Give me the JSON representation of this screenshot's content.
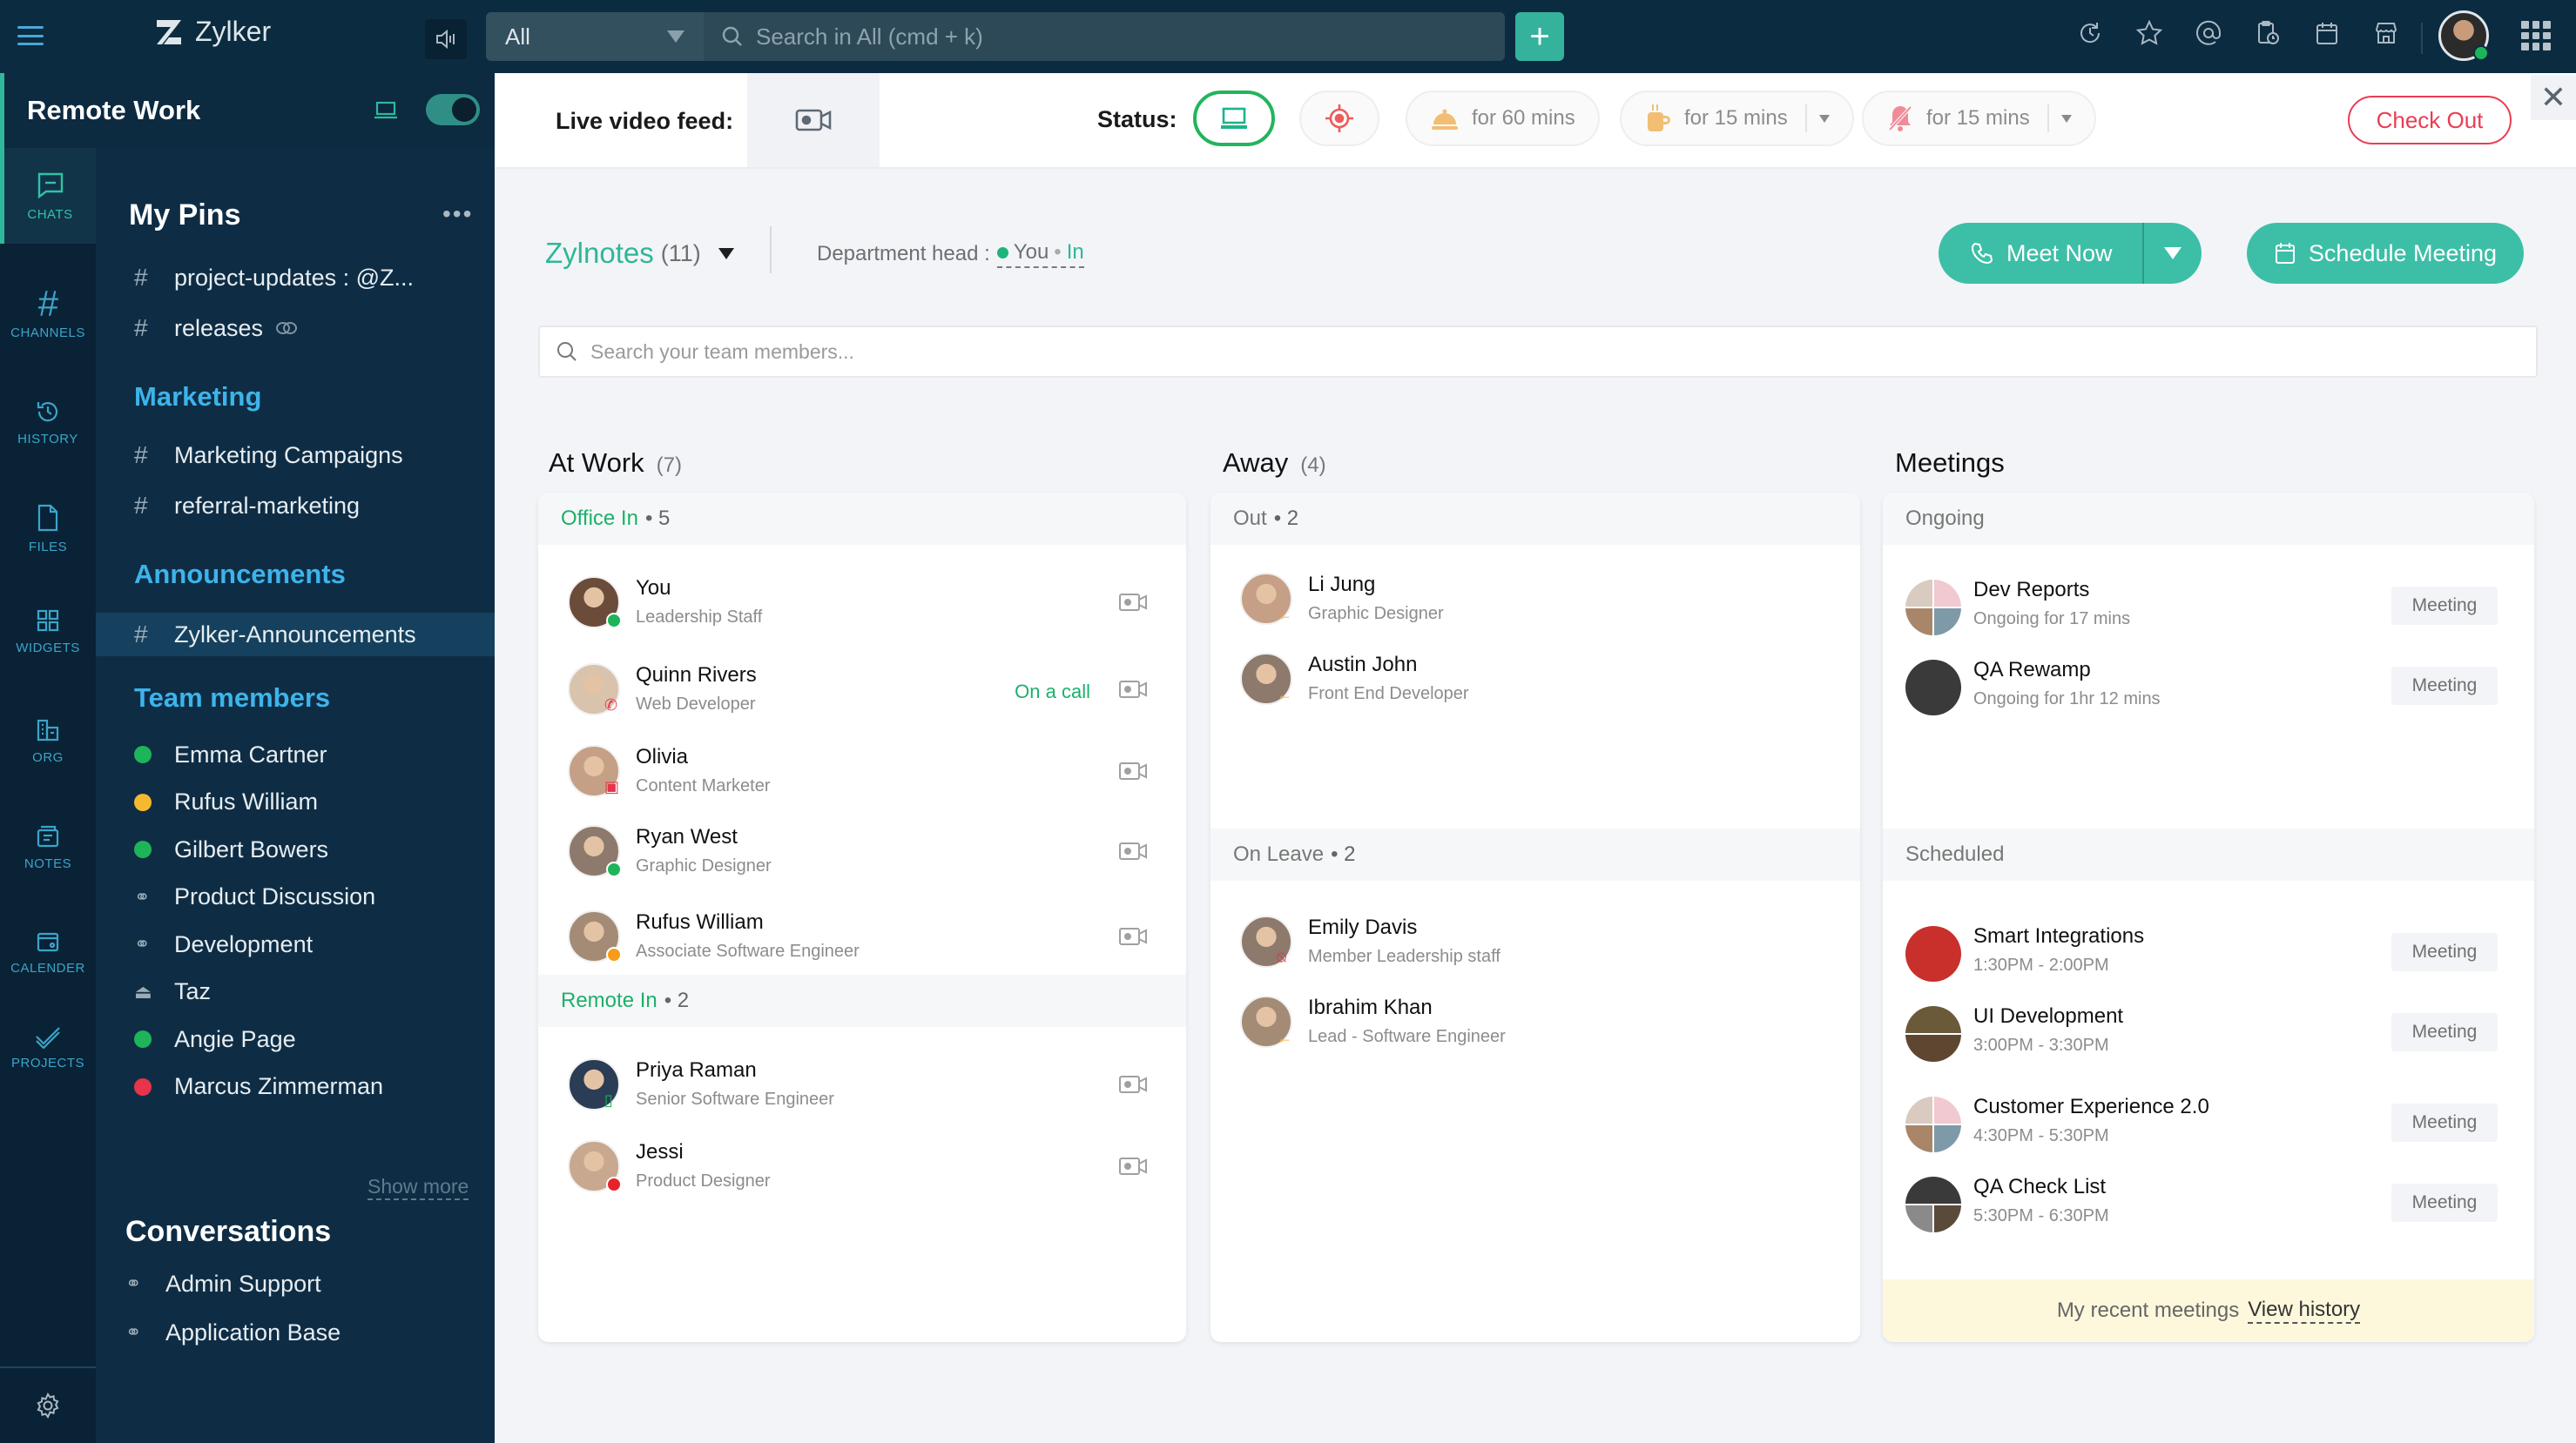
{
  "app": {
    "name": "Zylker",
    "scope_select": "All",
    "search_placeholder": "Search in All (cmd + k)",
    "add_label": "+",
    "top_icons": [
      "history-icon",
      "star-icon",
      "mention-icon",
      "clipboard-clock-icon",
      "calendar-icon",
      "store-icon"
    ],
    "user_status_color": "#1db45a"
  },
  "rail": {
    "items": [
      {
        "label": "CHATS",
        "icon": "chat-icon",
        "active": true
      },
      {
        "label": "CHANNELS",
        "icon": "hash-icon"
      },
      {
        "label": "HISTORY",
        "icon": "history-icon"
      },
      {
        "label": "FILES",
        "icon": "file-icon"
      },
      {
        "label": "WIDGETS",
        "icon": "widgets-icon"
      },
      {
        "label": "ORG",
        "icon": "org-icon"
      },
      {
        "label": "NOTES",
        "icon": "notes-icon"
      },
      {
        "label": "CALENDER",
        "icon": "calendar-icon"
      },
      {
        "label": "PROJECTS",
        "icon": "projects-icon"
      }
    ]
  },
  "sidebar": {
    "workspace": "Remote Work",
    "pins_title": "My Pins",
    "pins": [
      {
        "label": "project-updates : @Z..."
      },
      {
        "label": "releases"
      }
    ],
    "marketing_title": "Marketing",
    "marketing": [
      {
        "label": "Marketing Campaigns"
      },
      {
        "label": "referral-marketing"
      }
    ],
    "announcements_title": "Announcements",
    "announcements": [
      {
        "label": "Zylker-Announcements"
      }
    ],
    "team_title": "Team members",
    "team": [
      {
        "label": "Emma  Cartner",
        "type": "dot",
        "color": "#1db45a"
      },
      {
        "label": "Rufus William",
        "type": "dot",
        "color": "#f5b82e"
      },
      {
        "label": "Gilbert Bowers",
        "type": "dot",
        "color": "#1db45a"
      },
      {
        "label": "Product Discussion",
        "type": "group"
      },
      {
        "label": "Development",
        "type": "group"
      },
      {
        "label": "Taz",
        "type": "bot"
      },
      {
        "label": "Angie Page",
        "type": "dot",
        "color": "#1db45a"
      },
      {
        "label": "Marcus Zimmerman",
        "type": "dot",
        "color": "#e8334a"
      }
    ],
    "show_more": "Show more",
    "conversations_title": "Conversations",
    "conversations": [
      {
        "label": "Admin Support"
      },
      {
        "label": "Application Base"
      }
    ]
  },
  "statusbar": {
    "live_label": "Live video feed:",
    "status_label": "Status:",
    "statuses": [
      {
        "name": "in-office",
        "label": "",
        "active": true
      },
      {
        "name": "focus",
        "label": ""
      },
      {
        "name": "lunch",
        "label": "for 60 mins"
      },
      {
        "name": "break",
        "label": "for 15 mins",
        "dropdown": true
      },
      {
        "name": "do-not-disturb",
        "label": "for 15 mins",
        "dropdown": true
      }
    ],
    "checkout": "Check Out"
  },
  "main": {
    "team_name": "Zylnotes",
    "team_count": "(11)",
    "dept_head_label": "Department head :",
    "dept_head_name": "You",
    "dept_head_state": "In",
    "meet_now": "Meet Now",
    "schedule_meeting": "Schedule Meeting",
    "search_placeholder": "Search your team members...",
    "at_work": {
      "title": "At Work",
      "count": "(7)",
      "office_in": {
        "label": "Office In",
        "count": "5"
      },
      "office_people": [
        {
          "name": "You",
          "role": "Leadership Staff",
          "badge": "online"
        },
        {
          "name": "Quinn Rivers",
          "role": "Web Developer",
          "badge": "call",
          "status_text": "On a call"
        },
        {
          "name": "Olivia",
          "role": "Content Marketer",
          "badge": "meeting"
        },
        {
          "name": "Ryan West",
          "role": "Graphic Designer",
          "badge": "online"
        },
        {
          "name": "Rufus William",
          "role": "Associate Software Engineer",
          "badge": "away"
        }
      ],
      "remote_in": {
        "label": "Remote In",
        "count": "2"
      },
      "remote_people": [
        {
          "name": "Priya Raman",
          "role": "Senior Software Engineer",
          "badge": "mobile"
        },
        {
          "name": "Jessi",
          "role": "Product Designer",
          "badge": "busy"
        }
      ]
    },
    "away": {
      "title": "Away",
      "count": "(4)",
      "out": {
        "label": "Out",
        "count": "2"
      },
      "out_people": [
        {
          "name": "Li Jung",
          "role": "Graphic Designer"
        },
        {
          "name": "Austin John",
          "role": "Front End Developer"
        }
      ],
      "leave": {
        "label": "On Leave",
        "count": "2"
      },
      "leave_people": [
        {
          "name": "Emily Davis",
          "role": "Member Leadership staff",
          "badge": "dnd"
        },
        {
          "name": "Ibrahim Khan",
          "role": "Lead - Software Engineer",
          "badge": "out"
        }
      ]
    },
    "meetings": {
      "title": "Meetings",
      "ongoing_label": "Ongoing",
      "ongoing": [
        {
          "name": "Dev Reports",
          "sub": "Ongoing for 17 mins",
          "action": "Meeting"
        },
        {
          "name": "QA Rewamp",
          "sub": "Ongoing for 1hr 12 mins",
          "action": "Meeting"
        }
      ],
      "scheduled_label": "Scheduled",
      "scheduled": [
        {
          "name": "Smart Integrations",
          "sub": "1:30PM - 2:00PM",
          "action": "Meeting"
        },
        {
          "name": "UI Development",
          "sub": "3:00PM - 3:30PM",
          "action": "Meeting"
        },
        {
          "name": "Customer Experience 2.0",
          "sub": "4:30PM - 5:30PM",
          "action": "Meeting"
        },
        {
          "name": "QA Check List",
          "sub": "5:30PM - 6:30PM",
          "action": "Meeting"
        }
      ],
      "recent_label": "My recent meetings",
      "view_history": "View history"
    }
  },
  "colors": {
    "accent": "#3dbfa7",
    "topbar": "#0b2b40",
    "sidebar": "#0e2d45",
    "online": "#1db45a",
    "away": "#f5b82e",
    "busy": "#e8334a",
    "checkout": "#ea3d52"
  }
}
